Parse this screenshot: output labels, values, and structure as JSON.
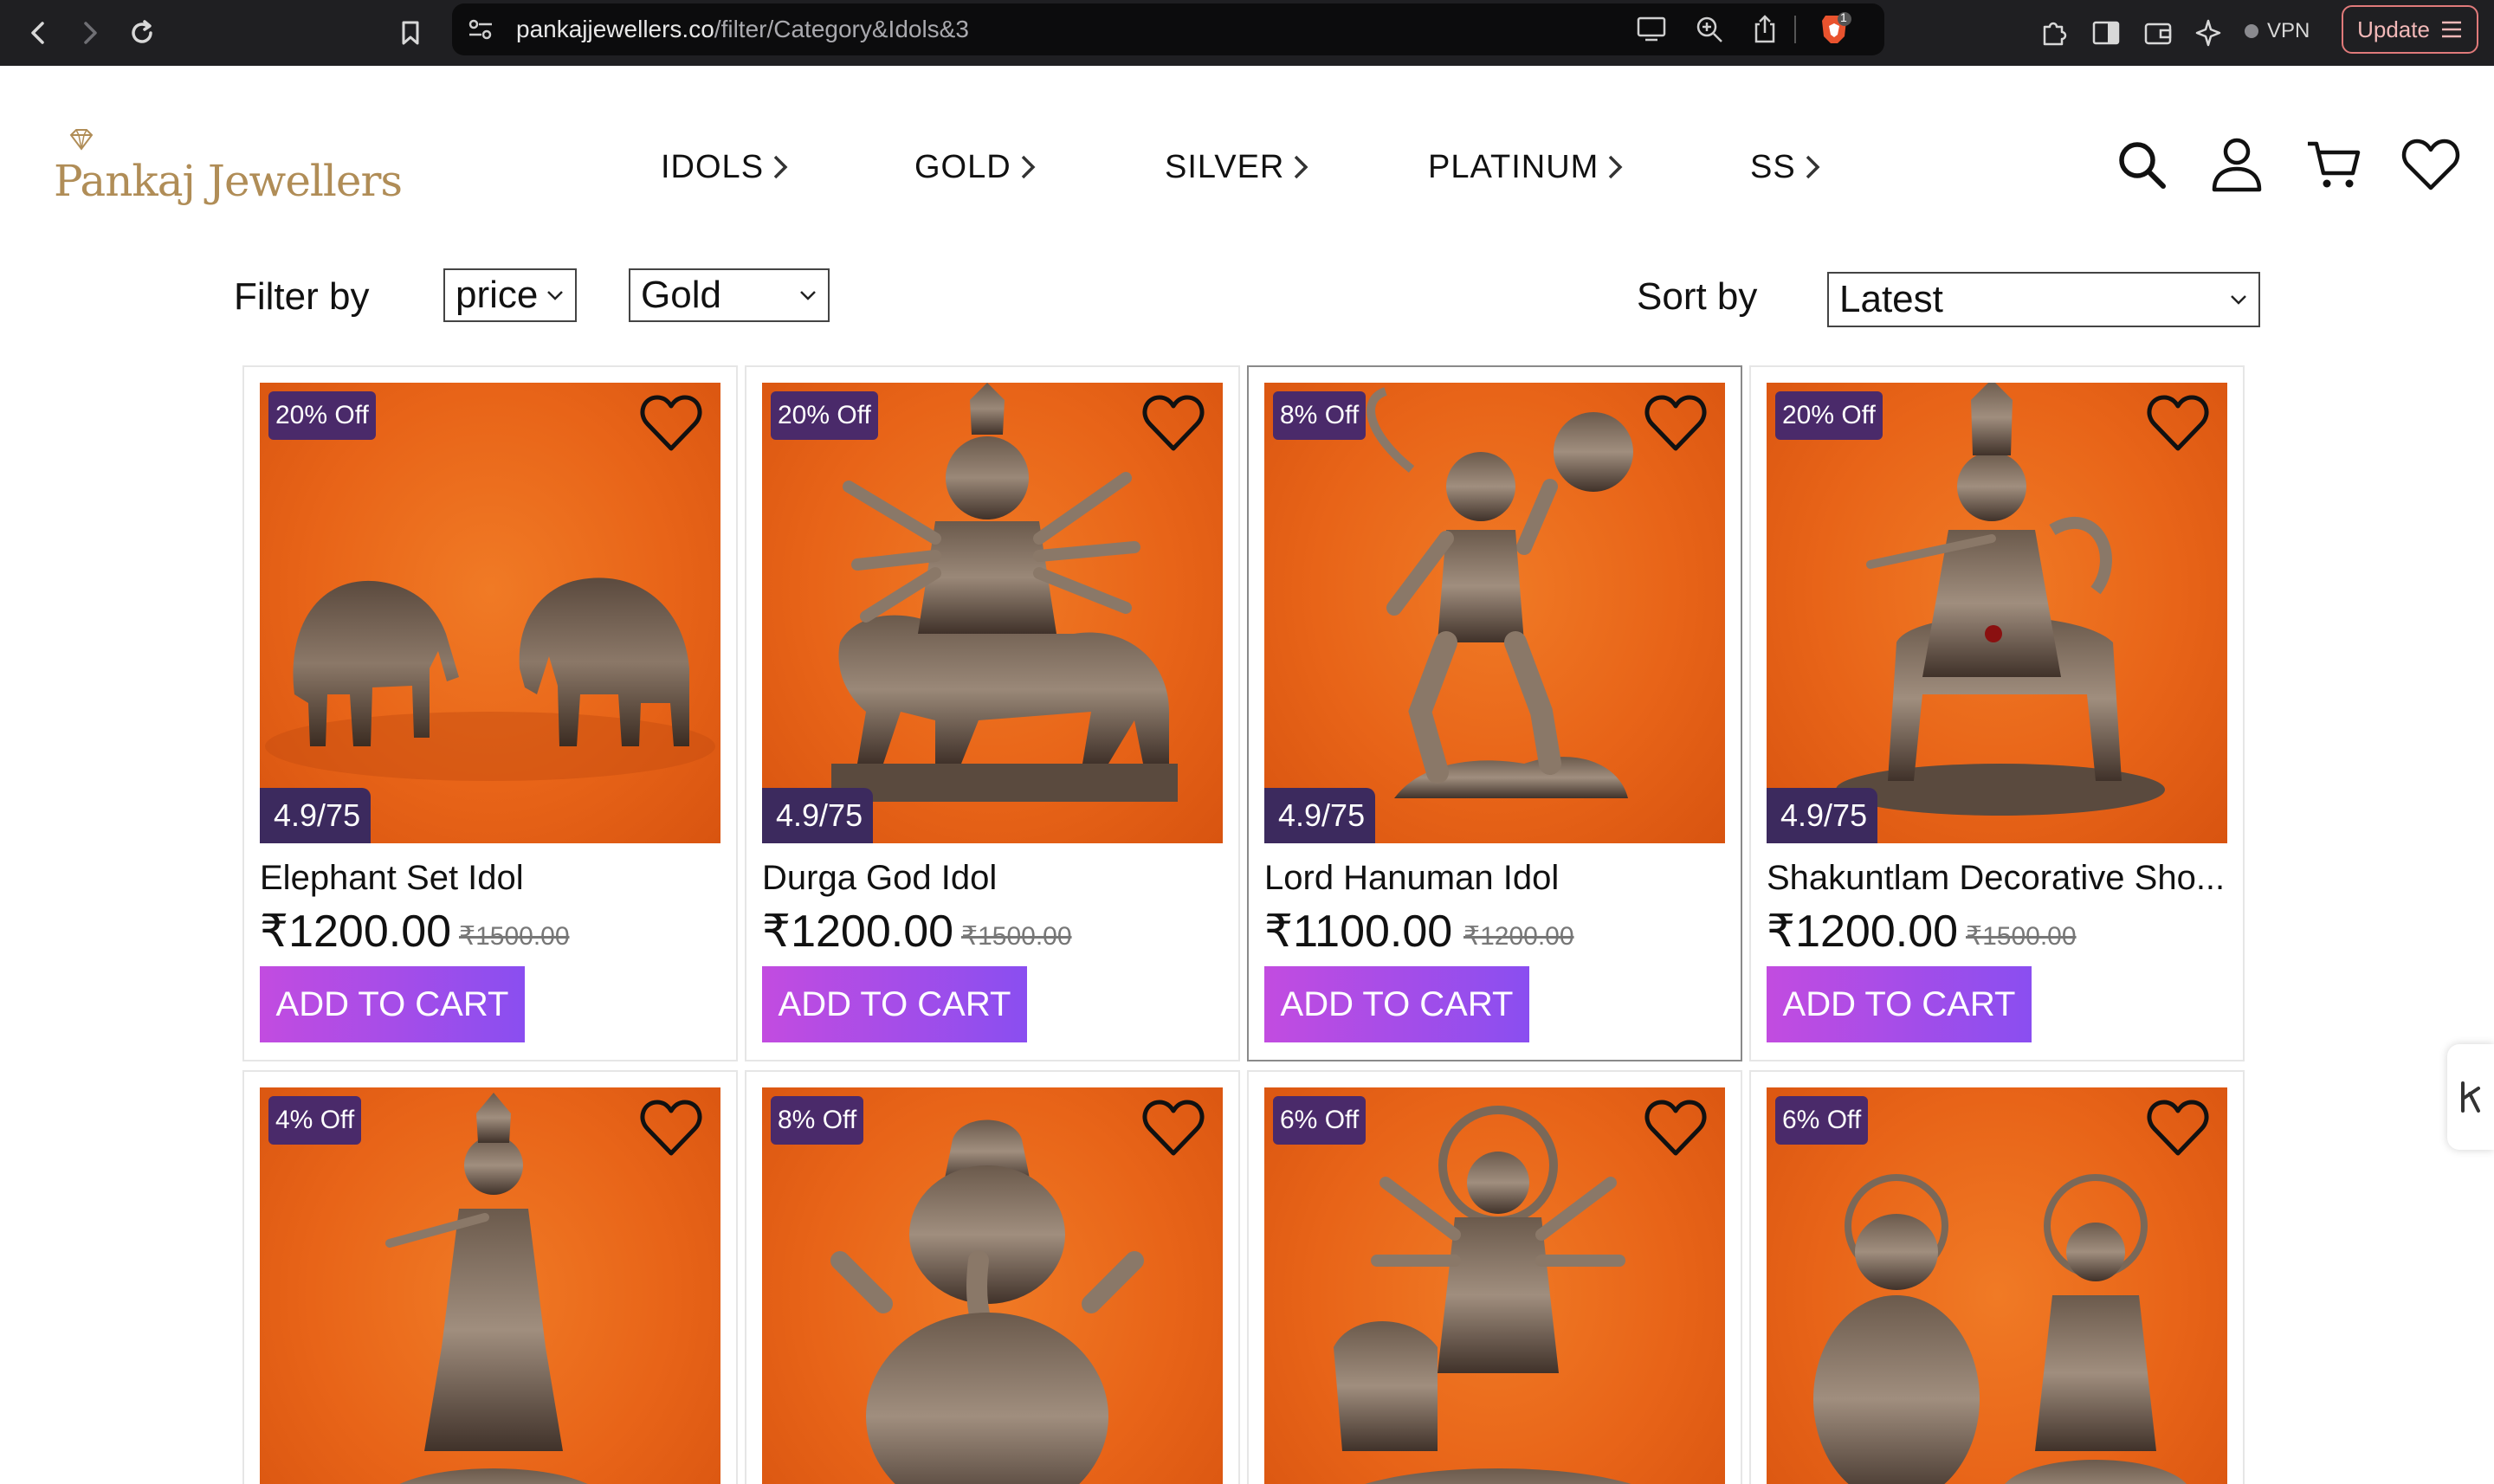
{
  "browser": {
    "url_host": "pankajjewellers.co",
    "url_path": "/filter/Category&Idols&3",
    "vpn_label": "VPN",
    "update_label": "Update",
    "shield_badge": "1"
  },
  "site": {
    "logo_text": "Pankaj Jewellers",
    "brand_color": "#b08d57",
    "nav": [
      {
        "label": "IDOLS"
      },
      {
        "label": "GOLD"
      },
      {
        "label": "SILVER"
      },
      {
        "label": "PLATINUM"
      },
      {
        "label": "SS"
      }
    ],
    "header_icons": [
      "search-icon",
      "user-icon",
      "cart-icon",
      "wishlist-icon"
    ]
  },
  "filters": {
    "filter_label": "Filter by",
    "price_select": "price",
    "metal_select": "Gold",
    "sort_label": "Sort by",
    "sort_select": "Latest"
  },
  "products": [
    {
      "discount": "20% Off",
      "rating": "4.9/75",
      "name": "Elephant Set Idol",
      "price": "₹1200.00",
      "old_price": "₹1500.00",
      "cta": "ADD TO CART",
      "figure": "elephants"
    },
    {
      "discount": "20% Off",
      "rating": "4.9/75",
      "name": "Durga God Idol",
      "price": "₹1200.00",
      "old_price": "₹1500.00",
      "cta": "ADD TO CART",
      "figure": "durga"
    },
    {
      "discount": "8% Off",
      "rating": "4.9/75",
      "name": "Lord Hanuman Idol",
      "price": "₹1100.00",
      "old_price": "₹1200.00",
      "cta": "ADD TO CART",
      "figure": "hanuman"
    },
    {
      "discount": "20% Off",
      "rating": "4.9/75",
      "name": "Shakuntlam Decorative Sho...",
      "price": "₹1200.00",
      "old_price": "₹1500.00",
      "cta": "ADD TO CART",
      "figure": "krishna-cow"
    },
    {
      "discount": "4% Off",
      "figure": "krishna"
    },
    {
      "discount": "8% Off",
      "figure": "ganesha"
    },
    {
      "discount": "6% Off",
      "figure": "durga-lion"
    },
    {
      "discount": "6% Off",
      "figure": "ganesha-lakshmi"
    }
  ],
  "colors": {
    "badge_bg": "#4a2a6a",
    "rating_bg": "#3c2a5e",
    "cta_gradient_start": "#c24ce0",
    "cta_gradient_end": "#8a4ef0",
    "image_bg": "#e86418"
  }
}
